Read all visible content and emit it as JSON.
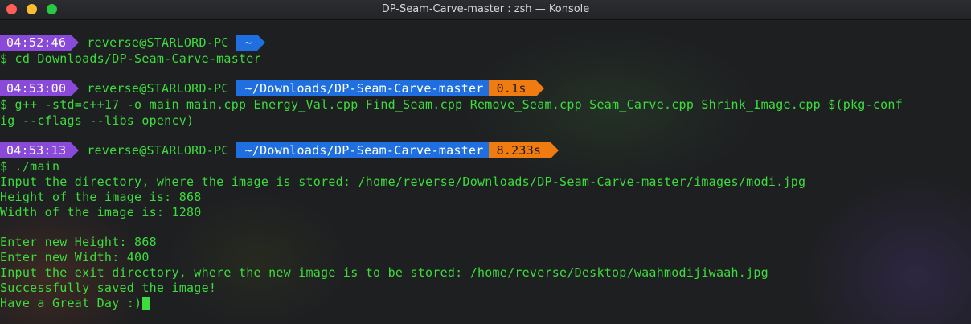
{
  "window": {
    "title": "DP-Seam-Carve-master : zsh — Konsole"
  },
  "colors": {
    "prompt_time_bg": "#8a4ad9",
    "prompt_dir_bg": "#1f6fe0",
    "prompt_duration_bg": "#f07b10",
    "text_green": "#3ddc3d"
  },
  "prompts": [
    {
      "time": "04:52:46",
      "user": "reverse@STARLORD-PC",
      "dir": "~",
      "duration": ""
    },
    {
      "time": "04:53:00",
      "user": "reverse@STARLORD-PC",
      "dir": "~/Downloads/DP-Seam-Carve-master",
      "duration": "0.1s"
    },
    {
      "time": "04:53:13",
      "user": "reverse@STARLORD-PC",
      "dir": "~/Downloads/DP-Seam-Carve-master",
      "duration": "8.233s"
    }
  ],
  "lines": {
    "cmd1": "$ cd Downloads/DP-Seam-Carve-master",
    "cmd2a": "$ g++ -std=c++17 -o main main.cpp Energy_Val.cpp Find_Seam.cpp Remove_Seam.cpp Seam_Carve.cpp Shrink_Image.cpp $(pkg-conf",
    "cmd2b": "ig --cflags --libs opencv)",
    "cmd3": "$ ./main",
    "out1": "Input the directory, where the image is stored: /home/reverse/Downloads/DP-Seam-Carve-master/images/modi.jpg",
    "out2": "Height of the image is: 868",
    "out3": "Width of the image is: 1280",
    "out4": "Enter new Height: 868",
    "out5": "Enter new Width: 400",
    "out6": "Input the exit directory, where the new image is to be stored: /home/reverse/Desktop/waahmodijiwaah.jpg",
    "out7": "Successfully saved the image!",
    "out8": "Have a Great Day :)"
  }
}
